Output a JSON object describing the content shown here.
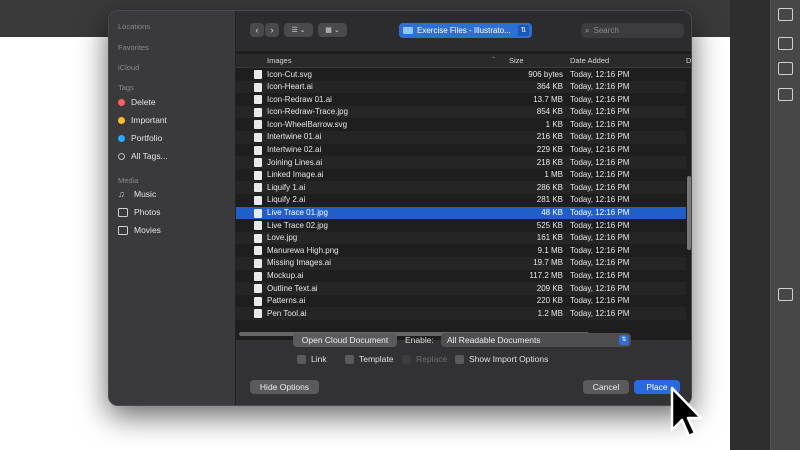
{
  "sidebar": {
    "sections": {
      "locations": "Locations",
      "favorites": "Favorites",
      "icloud": "iCloud",
      "tags": "Tags",
      "media": "Media"
    },
    "tags": [
      {
        "label": "Delete",
        "color": "#ff5f57"
      },
      {
        "label": "Important",
        "color": "#febc2e"
      },
      {
        "label": "Portfolio",
        "color": "#28a8ff"
      },
      {
        "label": "All Tags...",
        "color": ""
      }
    ],
    "media": [
      {
        "label": "Music",
        "icon": "music-note-icon"
      },
      {
        "label": "Photos",
        "icon": "camera-icon"
      },
      {
        "label": "Movies",
        "icon": "film-icon"
      }
    ]
  },
  "toolbar": {
    "back": "‹",
    "forward": "›",
    "view_list": "☰ ⌄",
    "view_grid": "▦ ⌄",
    "path": "Exercise Files - Illustrato...",
    "search_placeholder": "Search"
  },
  "columns": {
    "name": "Images",
    "size": "Size",
    "date": "Date Added",
    "extra": "Da"
  },
  "files": [
    {
      "name": "Icon-Cut.svg",
      "size": "906 bytes",
      "date": "Today, 12:16 PM",
      "selected": false
    },
    {
      "name": "Icon-Heart.ai",
      "size": "364 KB",
      "date": "Today, 12:16 PM",
      "selected": false
    },
    {
      "name": "Icon-Redraw 01.ai",
      "size": "13.7 MB",
      "date": "Today, 12:16 PM",
      "selected": false
    },
    {
      "name": "Icon-Redraw-Trace.jpg",
      "size": "854 KB",
      "date": "Today, 12:16 PM",
      "selected": false
    },
    {
      "name": "Icon-WheelBarrow.svg",
      "size": "1 KB",
      "date": "Today, 12:16 PM",
      "selected": false
    },
    {
      "name": "Intertwine 01.ai",
      "size": "216 KB",
      "date": "Today, 12:16 PM",
      "selected": false
    },
    {
      "name": "Intertwine 02.ai",
      "size": "229 KB",
      "date": "Today, 12:16 PM",
      "selected": false
    },
    {
      "name": "Joining Lines.ai",
      "size": "218 KB",
      "date": "Today, 12:16 PM",
      "selected": false
    },
    {
      "name": "Linked Image.ai",
      "size": "1 MB",
      "date": "Today, 12:16 PM",
      "selected": false
    },
    {
      "name": "Liquify 1.ai",
      "size": "286 KB",
      "date": "Today, 12:16 PM",
      "selected": false
    },
    {
      "name": "Liquify 2.ai",
      "size": "281 KB",
      "date": "Today, 12:16 PM",
      "selected": false
    },
    {
      "name": "Live Trace 01.jpg",
      "size": "48 KB",
      "date": "Today, 12:16 PM",
      "selected": true
    },
    {
      "name": "Live Trace 02.jpg",
      "size": "525 KB",
      "date": "Today, 12:16 PM",
      "selected": false
    },
    {
      "name": "Love.jpg",
      "size": "161 KB",
      "date": "Today, 12:16 PM",
      "selected": false
    },
    {
      "name": "Manurewa High.png",
      "size": "9.1 MB",
      "date": "Today, 12:16 PM",
      "selected": false
    },
    {
      "name": "Missing Images.ai",
      "size": "19.7 MB",
      "date": "Today, 12:16 PM",
      "selected": false
    },
    {
      "name": "Mockup.ai",
      "size": "117.2 MB",
      "date": "Today, 12:16 PM",
      "selected": false
    },
    {
      "name": "Outline Text.ai",
      "size": "209 KB",
      "date": "Today, 12:16 PM",
      "selected": false
    },
    {
      "name": "Patterns.ai",
      "size": "220 KB",
      "date": "Today, 12:16 PM",
      "selected": false
    },
    {
      "name": "Pen Tool.ai",
      "size": "1.2 MB",
      "date": "Today, 12:16 PM",
      "selected": false
    }
  ],
  "options": {
    "open_cloud": "Open Cloud Document",
    "enable_label": "Enable:",
    "enable_value": "All Readable Documents",
    "link": "Link",
    "template": "Template",
    "replace": "Replace",
    "show_import": "Show Import Options"
  },
  "footer": {
    "hide_options": "Hide Options",
    "cancel": "Cancel",
    "place": "Place"
  },
  "colors": {
    "accent": "#2a6ae0",
    "selection": "#1f5fc7"
  }
}
